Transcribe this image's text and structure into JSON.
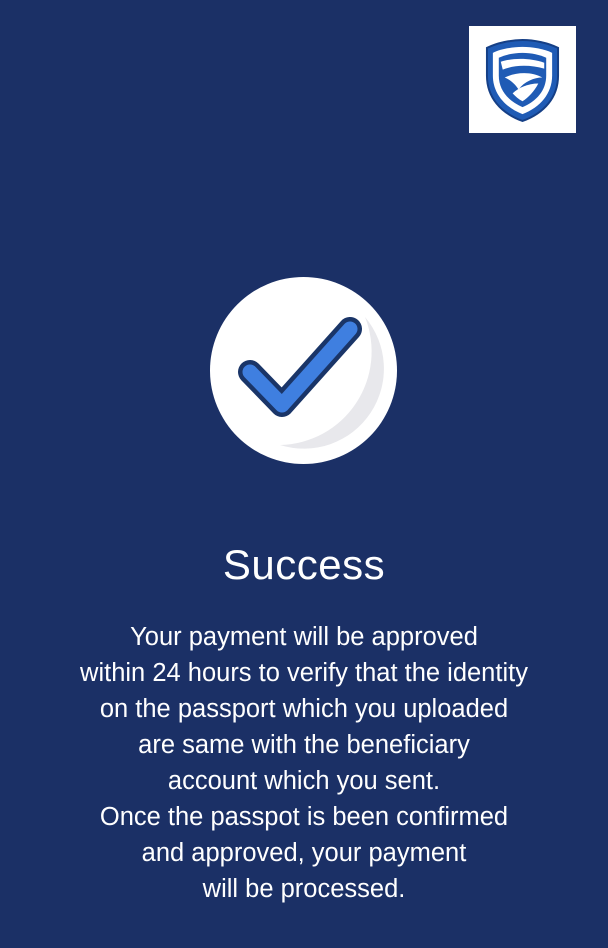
{
  "colors": {
    "background": "#1b3066",
    "logo_shield": "#1f5bb5",
    "check_fill": "#3f7fe0",
    "check_outline": "#1a3568",
    "circle": "#ffffff"
  },
  "logo": {
    "icon": "standard-bank-shield-icon"
  },
  "status_icon": "checkmark-circle-icon",
  "title": "Success",
  "message_lines": [
    "Your payment will be approved",
    "within 24 hours to verify that the identity",
    "on the passport which you uploaded",
    "are same with the beneficiary",
    "account which you sent.",
    "Once the passpot is been confirmed",
    "and approved, your payment",
    "will be processed."
  ]
}
